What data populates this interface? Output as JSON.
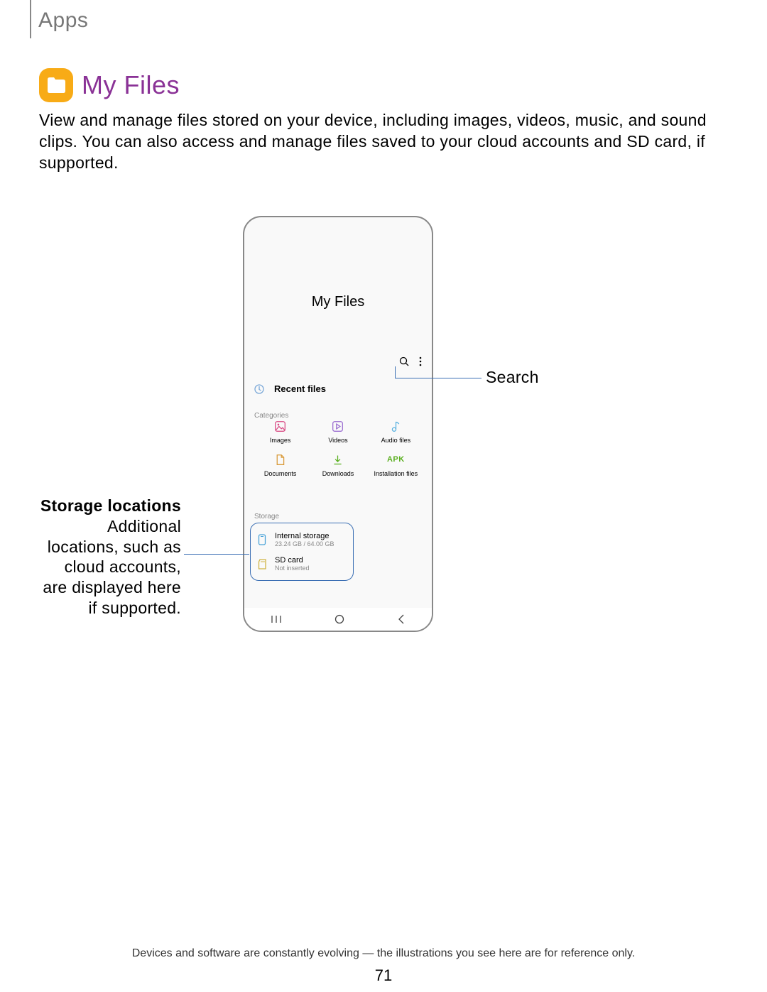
{
  "header": "Apps",
  "section": {
    "icon": "folder-icon",
    "title": "My Files",
    "description": "View and manage files stored on your device, including images, videos, music, and sound clips. You can also access and manage files saved to your cloud accounts and SD card, if supported."
  },
  "phone": {
    "title": "My Files",
    "recent_label": "Recent files",
    "section_categories": "Categories",
    "section_storage": "Storage",
    "categories": [
      {
        "label": "Images"
      },
      {
        "label": "Videos"
      },
      {
        "label": "Audio files"
      },
      {
        "label": "Documents"
      },
      {
        "label": "Downloads"
      },
      {
        "label": "Installation files",
        "apk": "APK"
      }
    ],
    "storage": [
      {
        "title": "Internal storage",
        "subtitle": "23.24 GB / 64.00 GB"
      },
      {
        "title": "SD card",
        "subtitle": "Not inserted"
      }
    ]
  },
  "callouts": {
    "search": "Search",
    "storage_title": "Storage locations",
    "storage_body": " Additional locations, such as cloud accounts, are displayed here if supported."
  },
  "footer": {
    "disclaimer": "Devices and software are constantly evolving — the illustrations you see here are for reference only.",
    "page": "71"
  }
}
